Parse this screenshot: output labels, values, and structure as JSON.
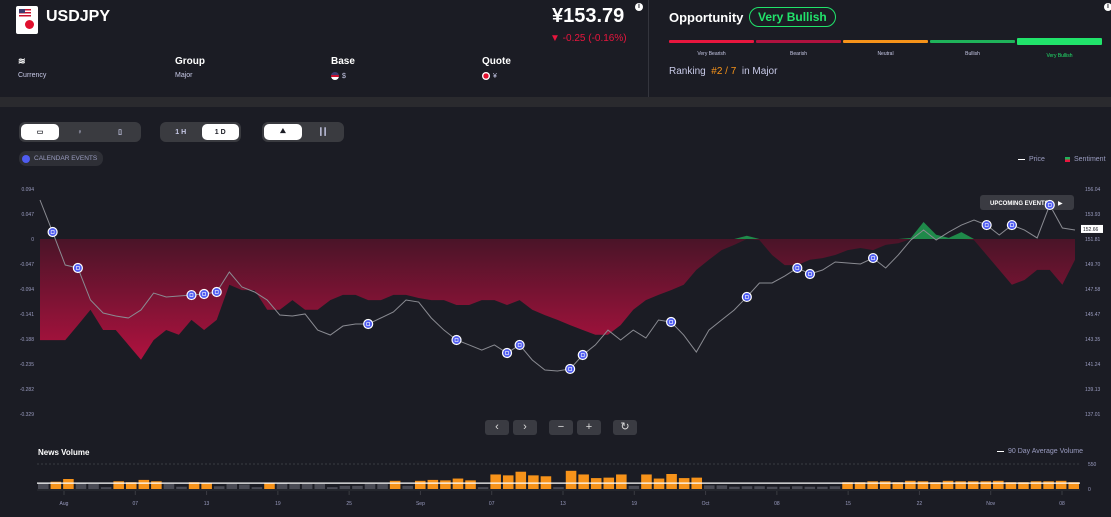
{
  "header": {
    "symbol": "USDJPY",
    "price": "¥153.79",
    "change": "▼ -0.25 (-0.16%)",
    "meta": [
      {
        "head": "",
        "value": "Currency",
        "icon": "layers-icon"
      },
      {
        "head": "Group",
        "value": "Major"
      },
      {
        "head": "Base",
        "value": "$",
        "flag": "us-flag"
      },
      {
        "head": "Quote",
        "value": "¥",
        "flag": "jp-flag"
      }
    ]
  },
  "opportunity": {
    "title": "Opportunity",
    "rating": "Very Bullish",
    "scale": [
      {
        "label": "Very Bearish",
        "color": "#e8163e"
      },
      {
        "label": "Bearish",
        "color": "#b0123f"
      },
      {
        "label": "Neutral",
        "color": "#f7931a"
      },
      {
        "label": "Bullish",
        "color": "#1fb35a"
      },
      {
        "label": "Very Bullish",
        "color": "#21e36b",
        "active": true
      }
    ],
    "ranking_label": "Ranking",
    "ranking": "#2 / 7",
    "ranking_suffix": "in Major"
  },
  "toolbar": {
    "views": [
      "calendar-icon",
      "lightbulb-icon",
      "document-icon"
    ],
    "timeframes": [
      "1 H",
      "1 D"
    ],
    "active_timeframe": "1 D",
    "chart_types": [
      "area-chart-icon",
      "candlestick-icon"
    ],
    "calendar_events": "CALENDAR EVENTS"
  },
  "chart_data": [
    {
      "type": "line",
      "legend": [
        "Price",
        "Sentiment"
      ],
      "legend_placement": "top-right",
      "left_ticks": [
        "0.094",
        "0.047",
        "0",
        "-0.047",
        "-0.094",
        "-0.141",
        "-0.188",
        "-0.235",
        "-0.282",
        "-0.329"
      ],
      "right_ticks": [
        "156.04",
        "153.93",
        "151.81",
        "149.70",
        "147.58",
        "145.47",
        "143.35",
        "141.24",
        "139.13",
        "137.01"
      ],
      "sentiment_range": [
        -0.329,
        0.094
      ],
      "price_range": [
        137.01,
        156.04
      ],
      "current_price": "152.66",
      "upcoming_label": "UPCOMING EVENTS",
      "colors": {
        "price": "#8a8b92",
        "negative": "#b0123f",
        "positive": "#1f8a4a",
        "event": "#4f5cf0"
      },
      "price": [
        155.11,
        152.4,
        149.61,
        149.36,
        146.65,
        145.55,
        145.3,
        145.13,
        145.81,
        147.24,
        146.91,
        146.99,
        147.07,
        147.16,
        147.33,
        149.02,
        147.75,
        147.33,
        146.65,
        145.38,
        145.3,
        145.47,
        144.11,
        143.69,
        144.45,
        144.62,
        144.62,
        145.13,
        145.64,
        146.65,
        146.48,
        145.13,
        144.11,
        143.27,
        142.85,
        142.42,
        142.85,
        142.17,
        142.85,
        141.58,
        140.73,
        140.65,
        140.82,
        142.0,
        142.85,
        144.11,
        143.27,
        144.11,
        143.44,
        144.96,
        144.79,
        143.69,
        142.25,
        144.11,
        144.96,
        145.81,
        146.91,
        148.09,
        148.09,
        148.68,
        149.36,
        148.85,
        149.19,
        149.87,
        149.78,
        149.7,
        150.2,
        149.36,
        150.46,
        151.73,
        152.57,
        151.73,
        152.4,
        152.99,
        153.42,
        152.99,
        152.15,
        152.99,
        152.57,
        151.9,
        154.69,
        152.74,
        152.57
      ],
      "sentiment": [
        -0.19,
        -0.19,
        -0.19,
        -0.162,
        -0.133,
        -0.171,
        -0.171,
        -0.199,
        -0.227,
        -0.19,
        -0.171,
        -0.18,
        -0.152,
        -0.171,
        -0.152,
        -0.086,
        -0.096,
        -0.096,
        -0.133,
        -0.133,
        -0.115,
        -0.133,
        -0.133,
        -0.115,
        -0.105,
        -0.105,
        -0.115,
        -0.115,
        -0.105,
        -0.105,
        -0.111,
        -0.115,
        -0.115,
        -0.124,
        -0.124,
        -0.115,
        -0.115,
        -0.124,
        -0.115,
        -0.133,
        -0.143,
        -0.152,
        -0.162,
        -0.171,
        -0.18,
        -0.18,
        -0.162,
        -0.133,
        -0.115,
        -0.105,
        -0.096,
        -0.086,
        -0.058,
        -0.039,
        -0.021,
        -0.011,
        0.006,
        -0.002,
        -0.03,
        -0.049,
        -0.049,
        -0.039,
        -0.036,
        -0.03,
        -0.021,
        -0.017,
        -0.021,
        -0.011,
        -0.008,
        0.002,
        0.032,
        0.008,
        0.002,
        0.013,
        -0.002,
        -0.03,
        -0.058,
        -0.086,
        -0.077,
        -0.058,
        -0.058,
        -0.086,
        -0.039
      ],
      "event_indices": [
        1,
        3,
        12,
        13,
        14,
        26,
        33,
        37,
        38,
        42,
        43,
        50,
        56,
        60,
        61,
        66,
        75,
        77,
        80
      ]
    },
    {
      "type": "bar",
      "title": "News Volume",
      "legend": [
        "90 Day Average Volume"
      ],
      "y_ticks": [
        "550",
        "0"
      ],
      "ylim": [
        0,
        550
      ],
      "average": 130,
      "x_ticks": [
        "Aug",
        "07",
        "13",
        "19",
        "25",
        "Sep",
        "07",
        "13",
        "19",
        "Oct",
        "08",
        "15",
        "22",
        "Nov",
        "08"
      ],
      "colors": {
        "above": "#f7931a",
        "below": "#4a4b55"
      },
      "values": [
        120,
        160,
        220,
        120,
        110,
        40,
        170,
        150,
        200,
        170,
        110,
        50,
        150,
        130,
        60,
        110,
        100,
        40,
        140,
        120,
        110,
        110,
        110,
        40,
        70,
        70,
        110,
        110,
        180,
        70,
        180,
        200,
        190,
        230,
        190,
        40,
        320,
        300,
        380,
        300,
        280,
        40,
        400,
        320,
        240,
        250,
        320,
        70,
        320,
        230,
        330,
        240,
        250,
        80,
        80,
        50,
        60,
        60,
        50,
        50,
        60,
        50,
        50,
        60,
        150,
        150,
        170,
        170,
        150,
        180,
        170,
        150,
        180,
        170,
        170,
        170,
        180,
        150,
        150,
        170,
        170,
        180,
        150
      ]
    }
  ],
  "nav": [
    "chevron-left-icon",
    "chevron-right-icon",
    "zoom-out-icon",
    "zoom-in-icon",
    "reset-icon"
  ]
}
